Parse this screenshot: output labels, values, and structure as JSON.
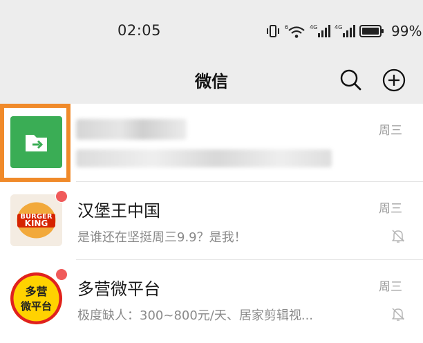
{
  "status_bar": {
    "time": "02:05",
    "battery": "99%"
  },
  "header": {
    "title": "微信"
  },
  "chats": [
    {
      "name": "",
      "preview": "",
      "time": "周三",
      "muted": false,
      "unread": false,
      "avatar": "file-transfer-icon",
      "avatar_color": "#3aad55"
    },
    {
      "name": "汉堡王中国",
      "preview": "是谁还在坚挺周三9.9？是我！",
      "time": "周三",
      "muted": true,
      "unread": true,
      "avatar": "burger-king-logo",
      "avatar_text": [
        "BURGER",
        "KING"
      ]
    },
    {
      "name": "多营微平台",
      "preview": "极度缺人：300~800元/天、居家剪辑视...",
      "time": "周三",
      "muted": true,
      "unread": true,
      "avatar": "duoying-logo",
      "avatar_text": [
        "多营",
        "微平台"
      ]
    }
  ],
  "colors": {
    "accent_highlight": "#f08a2a",
    "unread": "#f05a5a",
    "file_transfer": "#3aad55"
  }
}
